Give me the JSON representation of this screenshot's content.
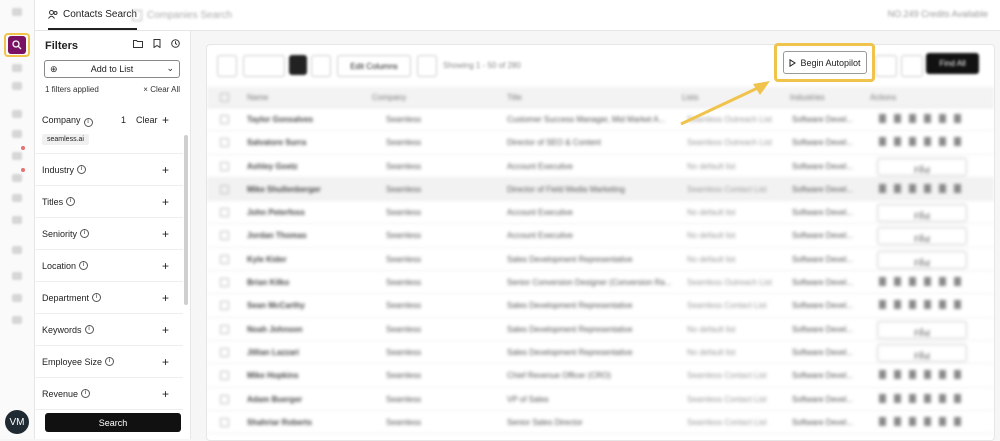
{
  "topbar": {
    "tabs": [
      {
        "label": "Contacts Search",
        "active": true
      },
      {
        "label": "Companies Search",
        "active": false
      }
    ],
    "credits": "NO.249 Credits Available"
  },
  "sidebar": {
    "avatar_initials": "VM"
  },
  "filters": {
    "title": "Filters",
    "add_to_list": "Add to List",
    "applied": "1 filters applied",
    "clear_all": "Clear All",
    "company": {
      "label": "Company",
      "count": "1",
      "clear": "Clear",
      "chip": "seamless.ai"
    },
    "items": [
      "Industry",
      "Titles",
      "Seniority",
      "Location",
      "Department",
      "Keywords",
      "Employee Size",
      "Revenue"
    ],
    "search_button": "Search"
  },
  "toolbar": {
    "edit_columns": "Edit Columns",
    "showing": "Showing 1 - 50 of 280",
    "begin_autopilot": "Begin Autopilot",
    "find_all": "Find All"
  },
  "table": {
    "columns": [
      "Name",
      "Company",
      "Title",
      "Lists",
      "Industries",
      "Actions"
    ],
    "find_label": "Find",
    "rows": [
      {
        "name": "Taylor Gonsalves",
        "company": "Seamless",
        "title": "Customer Success Manager, Mid Market A...",
        "list": "Seamless Outreach List",
        "industry": "Software Devel...",
        "found": true
      },
      {
        "name": "Salvatore Surra",
        "company": "Seamless",
        "title": "Director of SEO & Content",
        "list": "Seamless Outreach List",
        "industry": "Software Devel...",
        "found": true
      },
      {
        "name": "Ashley Goetz",
        "company": "Seamless",
        "title": "Account Executive",
        "list": "No default list",
        "industry": "Software Devel...",
        "found": false
      },
      {
        "name": "Mike Shullenberger",
        "company": "Seamless",
        "title": "Director of Field Media Marketing",
        "list": "Seamless Contact List",
        "industry": "Software Devel...",
        "found": true
      },
      {
        "name": "John Peterfoss",
        "company": "Seamless",
        "title": "Account Executive",
        "list": "No default list",
        "industry": "Software Devel...",
        "found": false
      },
      {
        "name": "Jordan Thomas",
        "company": "Seamless",
        "title": "Account Executive",
        "list": "No default list",
        "industry": "Software Devel...",
        "found": false
      },
      {
        "name": "Kyle Kider",
        "company": "Seamless",
        "title": "Sales Development Representative",
        "list": "No default list",
        "industry": "Software Devel...",
        "found": false
      },
      {
        "name": "Brian Kilko",
        "company": "Seamless",
        "title": "Senior Conversion Designer (Conversion Ra...",
        "list": "Seamless Outreach List",
        "industry": "Software Devel...",
        "found": true
      },
      {
        "name": "Sean McCarthy",
        "company": "Seamless",
        "title": "Sales Development Representative",
        "list": "Seamless Contact List",
        "industry": "Software Devel...",
        "found": true
      },
      {
        "name": "Noah Johnson",
        "company": "Seamless",
        "title": "Sales Development Representative",
        "list": "No default list",
        "industry": "Software Devel...",
        "found": false
      },
      {
        "name": "Jillian Lazzari",
        "company": "Seamless",
        "title": "Sales Development Representative",
        "list": "No default list",
        "industry": "Software Devel...",
        "found": false
      },
      {
        "name": "Mike Hopkins",
        "company": "Seamless",
        "title": "Chief Revenue Officer (CRO)",
        "list": "Seamless Contact List",
        "industry": "Software Devel...",
        "found": true
      },
      {
        "name": "Adam Buerger",
        "company": "Seamless",
        "title": "VP of Sales",
        "list": "Seamless Contact List",
        "industry": "Software Devel...",
        "found": true
      },
      {
        "name": "Shahriar Roberts",
        "company": "Seamless",
        "title": "Senior Sales Director",
        "list": "Seamless Contact List",
        "industry": "Software Devel...",
        "found": true
      }
    ]
  },
  "colors": {
    "brand": "#7a1264",
    "highlight": "#f0c44c",
    "primary_button": "#111111"
  }
}
